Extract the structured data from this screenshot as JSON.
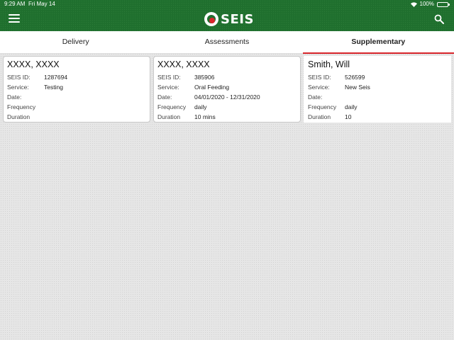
{
  "status_bar": {
    "time": "9:29 AM",
    "date": "Fri May 14",
    "battery": "100%"
  },
  "header": {
    "logo_text": "SEIS",
    "menu_icon": "hamburger-menu-icon",
    "search_icon": "search-icon",
    "accent": "#1f6f2e",
    "highlight": "#d9262c"
  },
  "tabs": [
    {
      "label": "Delivery",
      "active": false
    },
    {
      "label": "Assessments",
      "active": false
    },
    {
      "label": "Supplementary",
      "active": true
    }
  ],
  "field_labels": {
    "seis_id": "SEIS ID:",
    "service": "Service:",
    "date": "Date:",
    "frequency": "Frequency",
    "duration": "Duration"
  },
  "cards": [
    {
      "name": "XXXX, XXXX",
      "seis_id": "1287694",
      "service": "Testing",
      "date": "",
      "frequency": "",
      "duration": ""
    },
    {
      "name": "XXXX, XXXX",
      "seis_id": "385906",
      "service": "Oral Feeding",
      "date": "04/01/2020 - 12/31/2020",
      "frequency": "daily",
      "duration": "10 mins"
    },
    {
      "name": "Smith, Will",
      "seis_id": "526599",
      "service": "New Seis",
      "date": "",
      "frequency": "daily",
      "duration": "10"
    }
  ]
}
